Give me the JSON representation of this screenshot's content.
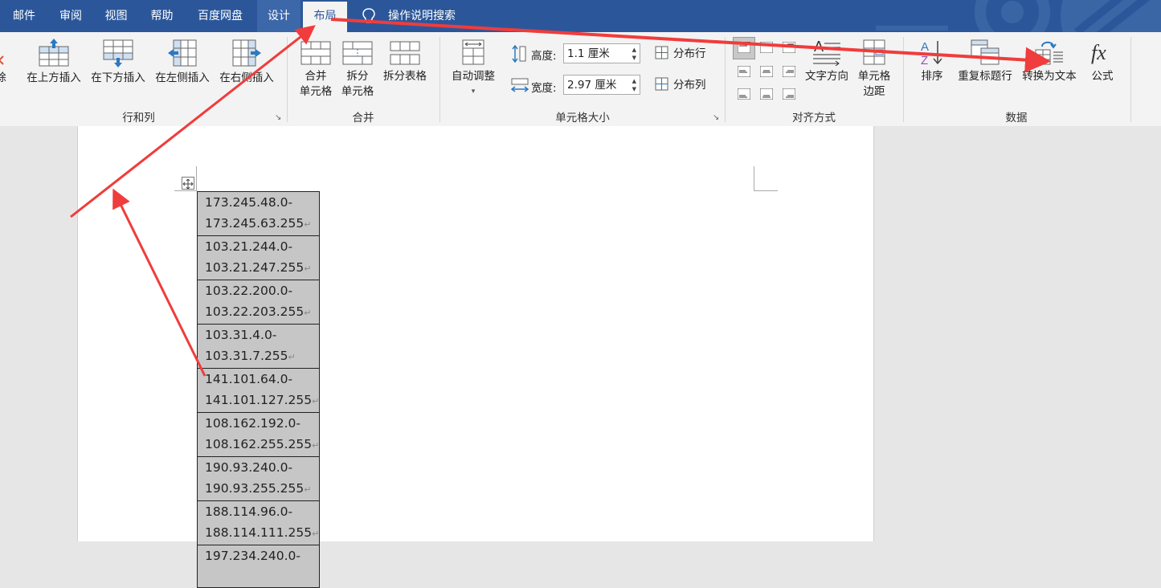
{
  "tabs": [
    {
      "label": "邮件"
    },
    {
      "label": "审阅"
    },
    {
      "label": "视图"
    },
    {
      "label": "帮助"
    },
    {
      "label": "百度网盘"
    },
    {
      "label": "设计"
    },
    {
      "label": "布局",
      "active": true
    }
  ],
  "tell_me": "操作说明搜索",
  "ribbon": {
    "rows_cols": {
      "partial_label": "除",
      "insert_above": "在上方插入",
      "insert_below": "在下方插入",
      "insert_left": "在左侧插入",
      "insert_right": "在右侧插入",
      "group_label": "行和列"
    },
    "merge": {
      "merge_cells_1": "合并",
      "merge_cells_2": "单元格",
      "split_cells_1": "拆分",
      "split_cells_2": "单元格",
      "split_table": "拆分表格",
      "group_label": "合并"
    },
    "cell_size": {
      "autofit": "自动调整",
      "height_label": "高度:",
      "height_value": "1.1 厘米",
      "width_label": "宽度:",
      "width_value": "2.97 厘米",
      "distribute_rows": "分布行",
      "distribute_cols": "分布列",
      "group_label": "单元格大小"
    },
    "alignment": {
      "text_direction": "文字方向",
      "cell_margins_1": "单元格",
      "cell_margins_2": "边距",
      "group_label": "对齐方式"
    },
    "data": {
      "sort": "排序",
      "repeat_header": "重复标题行",
      "convert_to_text": "转换为文本",
      "formula": "公式",
      "group_label": "数据"
    }
  },
  "table_rows": [
    {
      "line1": "173.245.48.0-",
      "line2": "173.245.63.255"
    },
    {
      "line1": "103.21.244.0-",
      "line2": "103.21.247.255"
    },
    {
      "line1": "103.22.200.0-",
      "line2": "103.22.203.255"
    },
    {
      "line1": "103.31.4.0-",
      "line2": "103.31.7.255"
    },
    {
      "line1": "141.101.64.0-",
      "line2": "141.101.127.255"
    },
    {
      "line1": "108.162.192.0-",
      "line2": "108.162.255.255"
    },
    {
      "line1": "190.93.240.0-",
      "line2": "190.93.255.255"
    },
    {
      "line1": "188.114.96.0-",
      "line2": "188.114.111.255"
    },
    {
      "line1": "197.234.240.0-",
      "line2": ""
    }
  ],
  "colors": {
    "titlebar": "#2b579a",
    "ribbon": "#f3f3f3",
    "annotation_arrow": "#f03c3c",
    "cell_selection": "#c6c6c6"
  }
}
